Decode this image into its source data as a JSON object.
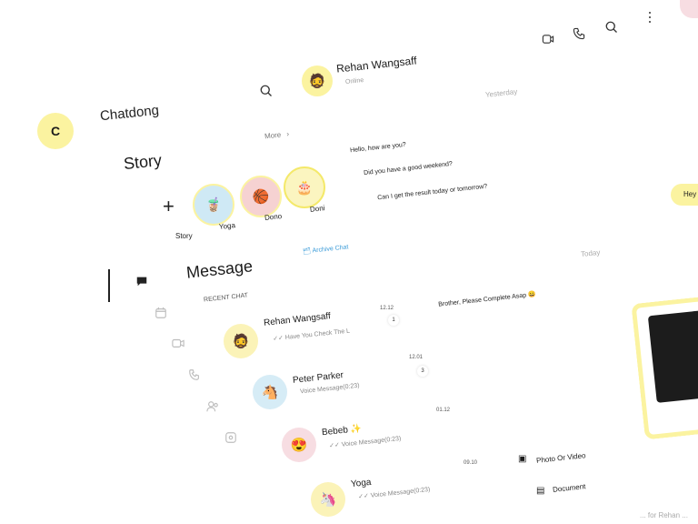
{
  "app": {
    "logo_letter": "C",
    "name": "Chatdong"
  },
  "story": {
    "title": "Story",
    "more_label": "More",
    "add_label": "Story",
    "items": [
      {
        "label": "Yoga",
        "emoji": "🧋",
        "bg": "#cfe9f5"
      },
      {
        "label": "Dono",
        "emoji": "🏀",
        "bg": "#f6d2d2"
      },
      {
        "label": "Doni",
        "emoji": "🎂",
        "bg": "#fbf5c0"
      }
    ]
  },
  "messages": {
    "title": "Message",
    "archive_label": "Archive Chat",
    "section_label": "RECENT CHAT",
    "items": [
      {
        "name": "Rehan Wangsaff",
        "preview": "Have You Check The L",
        "time": "12.12",
        "badge": "1",
        "emoji": "🧔",
        "bg": "#fbf3b8"
      },
      {
        "name": "Peter Parker",
        "preview": "Voice Message(0:23)",
        "time": "12.01",
        "badge": "3",
        "emoji": "🐴",
        "bg": "#d6ecf6"
      },
      {
        "name": "Bebeb",
        "preview": "Voice Message(0:23)",
        "time": "01.12",
        "badge": "",
        "emoji": "😍",
        "bg": "#f7dde2",
        "star": "✨"
      },
      {
        "name": "Yoga",
        "preview": "Voice Message(0:23)",
        "time": "09.10",
        "badge": "",
        "emoji": "🦄",
        "bg": "#fbf3b8"
      }
    ]
  },
  "chat": {
    "contact_name": "Rehan Wangsaff",
    "status": "Online",
    "day1": "Yesterday",
    "msgs_day1": [
      "Hello, how are you?",
      "Did you have a good weekend?",
      "Can I get the result today or tomorrow?"
    ],
    "outgoing_partial": "Hey",
    "day2": "Today",
    "msg_today": "Brother, Please Complete Asap 😀",
    "attach_photo": "Photo Or Video",
    "attach_doc": "Document",
    "input_placeholder": "... for Rehan ..."
  },
  "colors": {
    "accent": "#fbf3a0",
    "accent_border": "#f4e96a",
    "link": "#3a9bd8",
    "muted": "#9a9a9a"
  }
}
